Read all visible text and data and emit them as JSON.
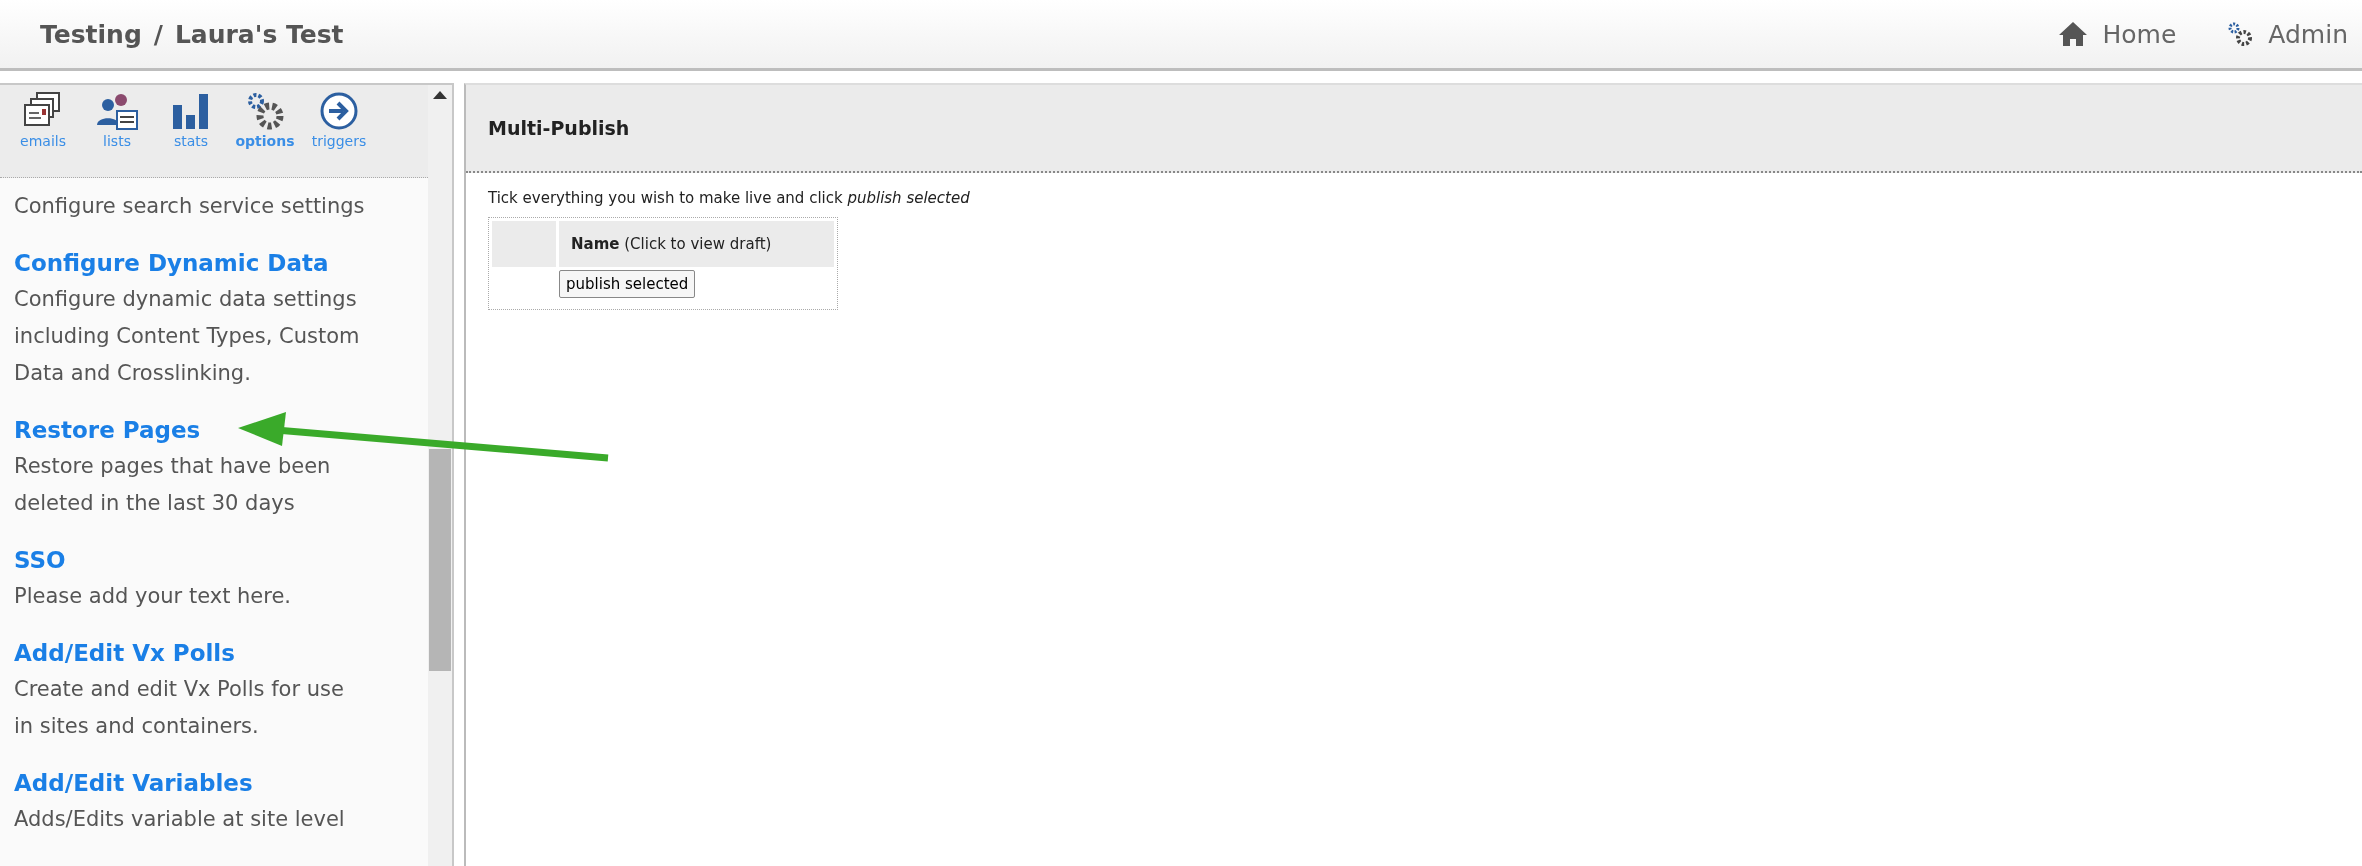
{
  "breadcrumb": [
    "Testing",
    "/",
    "Laura's Test"
  ],
  "header_links": [
    {
      "label": "Home",
      "kind": "home"
    },
    {
      "label": "Admin",
      "kind": "admin"
    }
  ],
  "toolbar": [
    {
      "label": "emails",
      "kind": "emails",
      "selected": false
    },
    {
      "label": "lists",
      "kind": "lists",
      "selected": false
    },
    {
      "label": "stats",
      "kind": "stats",
      "selected": false
    },
    {
      "label": "options",
      "kind": "options",
      "selected": true
    },
    {
      "label": "triggers",
      "kind": "triggers",
      "selected": false
    }
  ],
  "sidebar": {
    "items": [
      {
        "description": "Configure search service settings"
      },
      {
        "title": "Configure Dynamic Data",
        "description": "Configure dynamic data settings including Content Types, Custom Data and Crosslinking."
      },
      {
        "title": "Restore Pages",
        "description": "Restore pages that have been deleted in the last 30 days"
      },
      {
        "title": "SSO",
        "description": "Please add your text here."
      },
      {
        "title": "Add/Edit Vx Polls",
        "description": "Create and edit Vx Polls for use in sites and containers."
      },
      {
        "title": "Add/Edit Variables",
        "description": "Adds/Edits variable at site level"
      }
    ]
  },
  "main": {
    "title": "Multi-Publish",
    "instruction": "Tick everything you wish to make live and click *publish selected*",
    "table": {
      "column_header": "**Name** (Click to view draft)",
      "button": "publish selected"
    }
  }
}
